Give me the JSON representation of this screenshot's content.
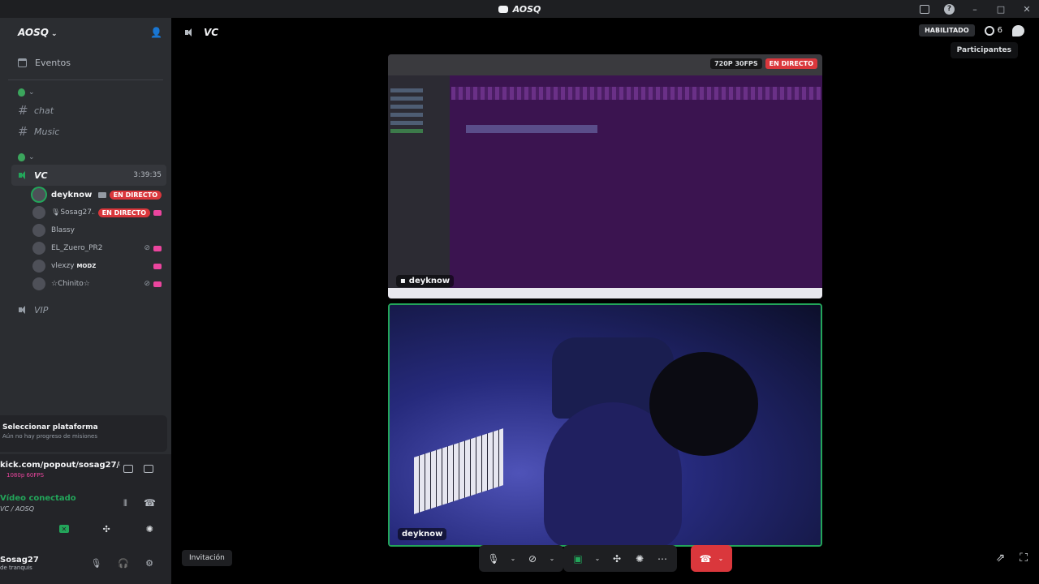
{
  "window": {
    "title": "AOSQ"
  },
  "sidebar": {
    "guild_name": "AOSQ",
    "events_label": "Eventos",
    "channels": [
      {
        "name": "chat"
      },
      {
        "name": "Music"
      }
    ],
    "voice_channel": {
      "name": "VC",
      "timer": "3:39:35"
    },
    "voice_users": [
      {
        "name": "deyknow",
        "badge": "EN DIRECTO"
      },
      {
        "name": "🎙Sosag27...",
        "badge": "EN DIRECTO"
      },
      {
        "name": "Blassy"
      },
      {
        "name": "EL_Zuero_PR2"
      },
      {
        "name": "vlexzy",
        "tag": "MODZ"
      },
      {
        "name": "☆Chinito☆"
      }
    ],
    "vip_channel": "VIP"
  },
  "quest": {
    "title": "Seleccionar plataforma",
    "subtitle": "Aún no hay progreso de misiones"
  },
  "stream": {
    "url": "kick.com/popout/sosag27/ch...",
    "quality": "1080p 60FPS"
  },
  "voice_status": {
    "status": "Vídeo conectado",
    "location": "VC / AOSQ"
  },
  "user": {
    "name": "Sosag27",
    "status": "de tranquis"
  },
  "header": {
    "channel": "VC",
    "habilitado": "HABILITADO",
    "participants_count": "6",
    "tooltip": "Participantes"
  },
  "tiles": [
    {
      "label": "deyknow",
      "quality": "720P 30FPS",
      "live": "EN DIRECTO"
    },
    {
      "label": "deyknow"
    }
  ],
  "invite_label": "Invitación",
  "colors": {
    "live": "#da373c",
    "speaking": "#23a55a",
    "sidebar": "#2b2d31"
  }
}
